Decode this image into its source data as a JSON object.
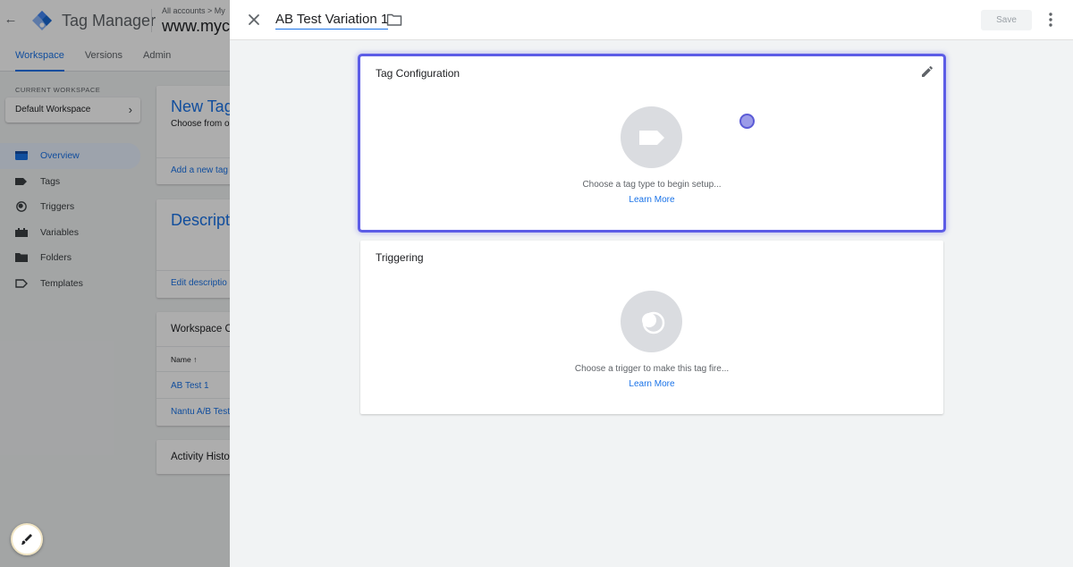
{
  "background": {
    "app_title": "Tag Manager",
    "breadcrumbs": "All accounts > My",
    "container_name": "www.myco",
    "nav_tabs": [
      {
        "label": "Workspace",
        "active": true
      },
      {
        "label": "Versions",
        "active": false
      },
      {
        "label": "Admin",
        "active": false
      }
    ],
    "current_workspace_label": "CURRENT WORKSPACE",
    "workspace_name": "Default Workspace",
    "sidebar": {
      "items": [
        {
          "label": "Overview",
          "icon": "overview-icon",
          "active": true
        },
        {
          "label": "Tags",
          "icon": "tag-icon",
          "active": false
        },
        {
          "label": "Triggers",
          "icon": "trigger-icon",
          "active": false
        },
        {
          "label": "Variables",
          "icon": "variables-icon",
          "active": false
        },
        {
          "label": "Folders",
          "icon": "folder-icon",
          "active": false
        },
        {
          "label": "Templates",
          "icon": "template-icon",
          "active": false
        }
      ]
    },
    "cards": {
      "new_tag_title": "New Tag",
      "new_tag_sub": "Choose from o",
      "new_tag_link": "Add a new tag",
      "description_title": "Descript",
      "description_link": "Edit descriptio",
      "workspace_changes_title": "Workspace C",
      "name_column": "Name",
      "rows": [
        "AB Test 1",
        "Nantu A/B Test"
      ],
      "activity_title": "Activity Histo"
    }
  },
  "panel": {
    "tag_name": "AB Test Variation 1",
    "save_label": "Save",
    "tag_configuration": {
      "title": "Tag Configuration",
      "hint": "Choose a tag type to begin setup...",
      "learn_more": "Learn More"
    },
    "triggering": {
      "title": "Triggering",
      "hint": "Choose a trigger to make this tag fire...",
      "learn_more": "Learn More"
    }
  },
  "colors": {
    "accent": "#1a73e8",
    "focus_ring": "#5c5ce6",
    "placeholder_circle": "#dadce0"
  }
}
